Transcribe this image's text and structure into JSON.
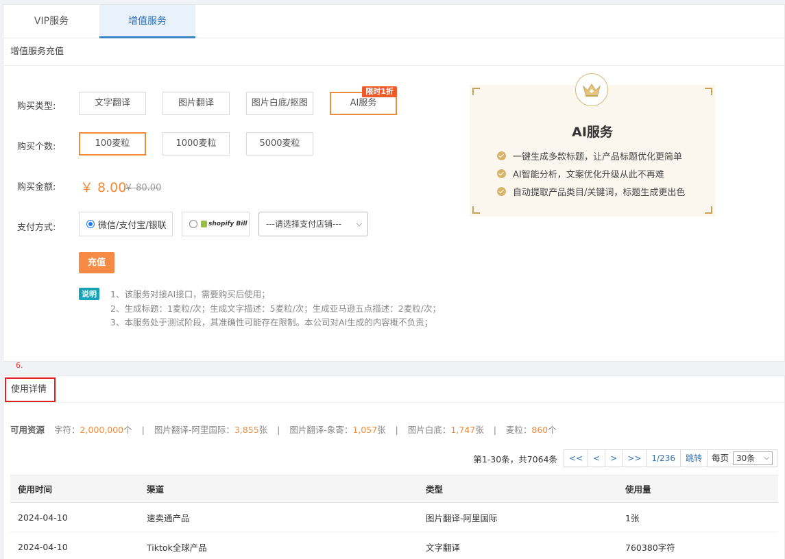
{
  "tabs": [
    {
      "label": "VIP服务"
    },
    {
      "label": "增值服务"
    }
  ],
  "recharge": {
    "section_title": "增值服务充值",
    "type_label": "购买类型:",
    "types": [
      "文字翻译",
      "图片翻译",
      "图片白底/抠图",
      "AI服务"
    ],
    "selected_type": "AI服务",
    "type_badge": "限时1折",
    "quantity_label": "购买个数:",
    "quantities": [
      "100麦粒",
      "1000麦粒",
      "5000麦粒"
    ],
    "selected_quantity": "100麦粒",
    "amount_label": "购买金额:",
    "price": "￥ 8.00",
    "original_price": "￥ 80.00",
    "payment_label": "支付方式:",
    "payment_option_1": "微信/支付宝/银联",
    "payment_option_2": "shopify Bill",
    "store_select": "---请选择支付店铺---",
    "charge_button": "充值",
    "note_tag": "说明",
    "notes": [
      "1、该服务对接AI接口，需要购买后使用；",
      "2、生成标题：1麦粒/次；生成文字描述：5麦粒/次；生成亚马逊五点描述：2麦粒/次；",
      "3、本服务处于测试阶段，其准确性可能存在限制。本公司对AI生成的内容概不负责；"
    ]
  },
  "promo": {
    "title": "AI服务",
    "features": [
      "一键生成多款标题，让产品标题优化更简单",
      "AI智能分析，文案优化升级从此不再难",
      "自动提取产品类目/关键词，标题生成更出色"
    ]
  },
  "marker": "6.",
  "usage": {
    "title": "使用详情",
    "resources_label": "可用资源",
    "resources": [
      {
        "name": "字符：",
        "value": "2,000,000",
        "unit": "个"
      },
      {
        "name": "图片翻译-阿里国际：",
        "value": "3,855",
        "unit": "张"
      },
      {
        "name": "图片翻译-象寄：",
        "value": "1,057",
        "unit": "张"
      },
      {
        "name": "图片白底：",
        "value": "1,747",
        "unit": "张"
      },
      {
        "name": "麦粒：",
        "value": "860",
        "unit": "个"
      }
    ],
    "separator": "|",
    "pager": {
      "total": "第1-30条，共7064条",
      "first": "<<",
      "prev": "<",
      "next": ">",
      "last": ">>",
      "page": "1/236",
      "jump": "跳转",
      "per_page_label": "每页",
      "per_page": "30条"
    },
    "columns": [
      "使用时间",
      "渠道",
      "类型",
      "使用量"
    ],
    "rows": [
      [
        "2024-04-10",
        "速卖通产品",
        "图片翻译-阿里国际",
        "1张"
      ],
      [
        "2024-04-10",
        "Tiktok全球产品",
        "文字翻译",
        "760380字符"
      ]
    ]
  },
  "colors": {
    "accent": "#f08a3c",
    "tab_active": "#3b82c4",
    "note_tag": "#17a2b8",
    "badge": "#f05a28",
    "highlight_border": "#e02020"
  }
}
